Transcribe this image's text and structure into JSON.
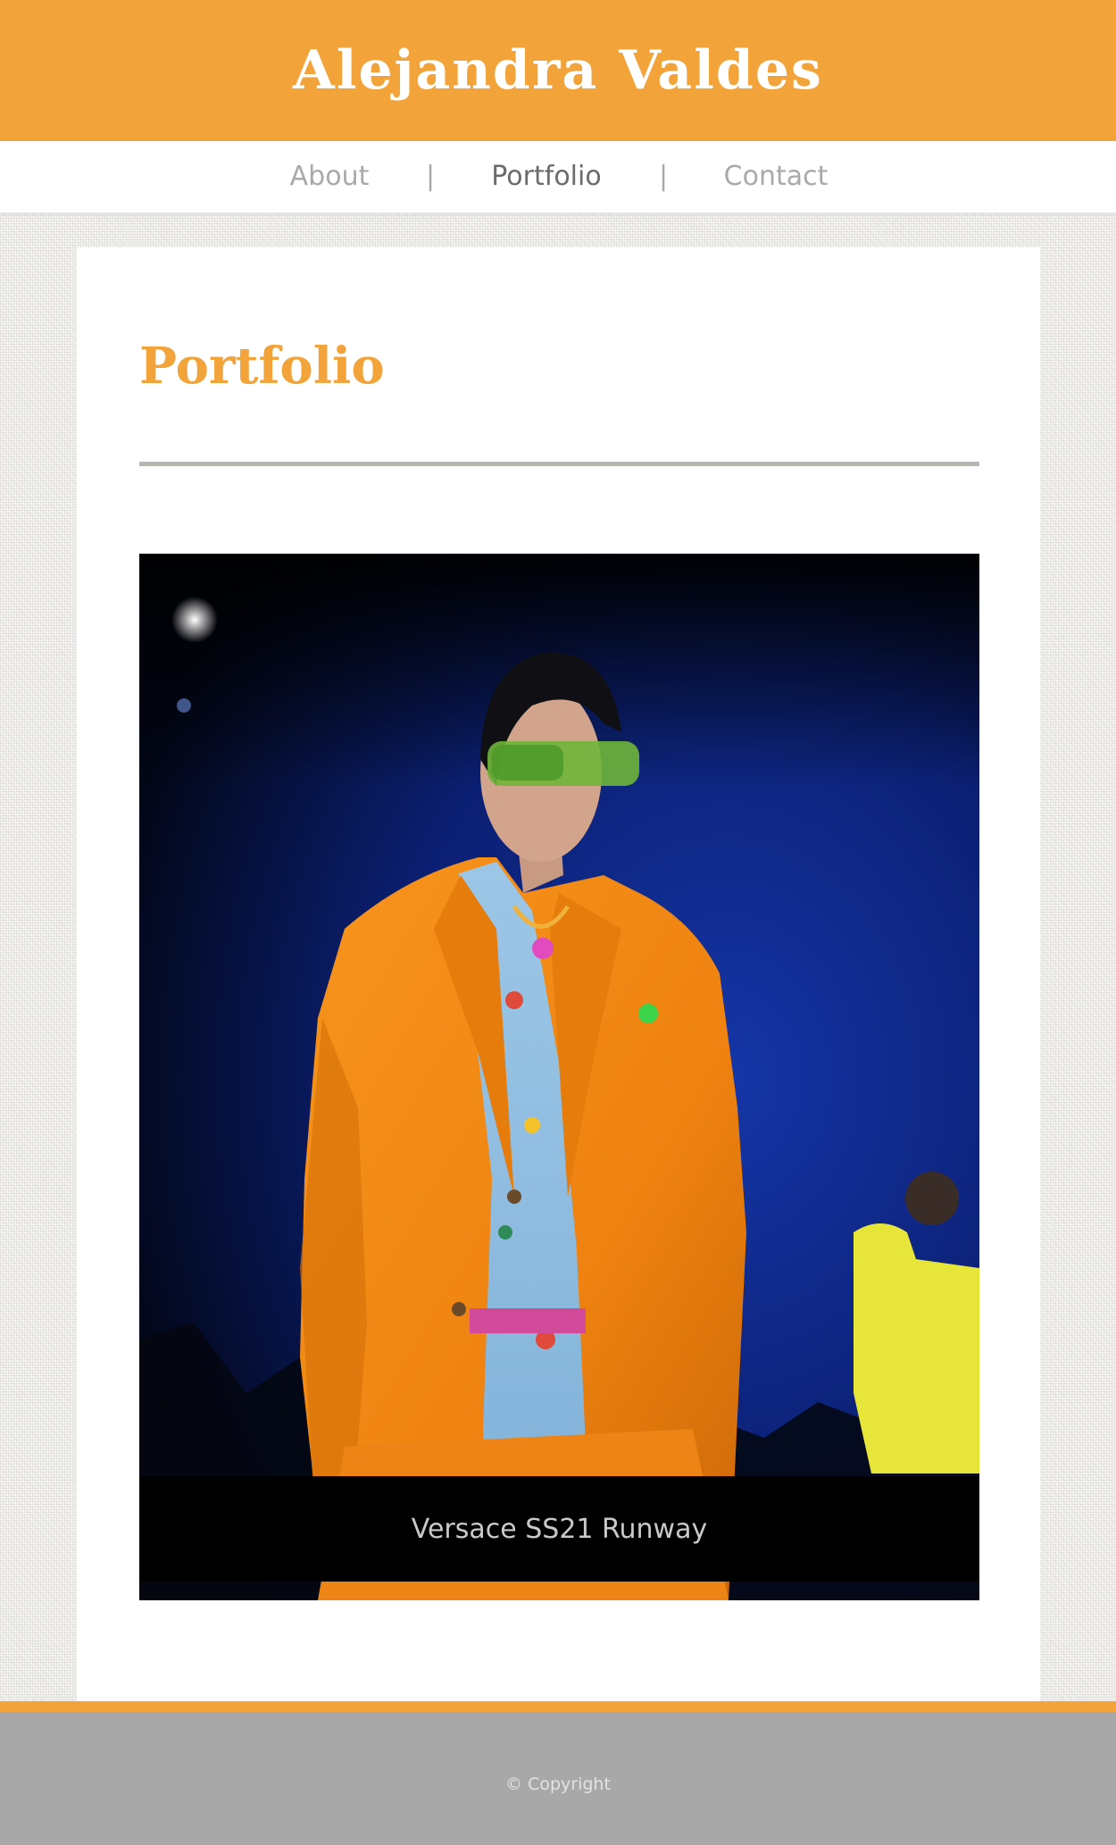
{
  "site": {
    "title": "Alejandra Valdes"
  },
  "nav": {
    "items": [
      {
        "label": "About",
        "active": false
      },
      {
        "label": "Portfolio",
        "active": true
      },
      {
        "label": "Contact",
        "active": false
      }
    ],
    "separator": "|"
  },
  "main": {
    "heading": "Portfolio",
    "image": {
      "caption": "Versace SS21 Runway"
    }
  },
  "footer": {
    "copyright": "© Copyright"
  },
  "colors": {
    "accent": "#f2a43a",
    "footer_bg": "#a8a8a8",
    "divider": "#b8b8b0"
  }
}
